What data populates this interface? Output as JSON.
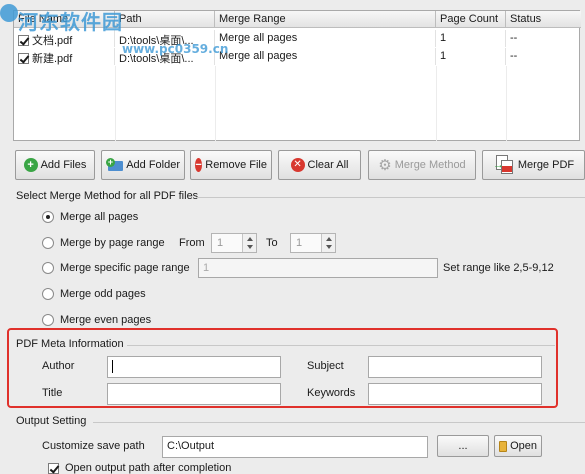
{
  "watermark": {
    "brand": "河东软件园",
    "url": "www.pc0359.cn"
  },
  "grid": {
    "columns": [
      "File Name",
      "Path",
      "Merge Range",
      "Page Count",
      "Status"
    ],
    "rows": [
      {
        "file": "文档.pdf",
        "path": "D:\\tools\\桌面\\...",
        "range": "Merge all pages",
        "count": "1",
        "status": "--"
      },
      {
        "file": "新建.pdf",
        "path": "D:\\tools\\桌面\\...",
        "range": "Merge all pages",
        "count": "1",
        "status": "--"
      }
    ]
  },
  "toolbar": {
    "add_files": "Add Files",
    "add_folder": "Add Folder",
    "remove_file": "Remove File",
    "clear_all": "Clear All",
    "merge_method": "Merge Method",
    "merge_pdf": "Merge PDF"
  },
  "method": {
    "title": "Select Merge Method for all PDF files",
    "all": "Merge all pages",
    "range": "Merge by page range",
    "from": "From",
    "to": "To",
    "from_value": "1",
    "to_value": "1",
    "specific": "Merge specific page range",
    "specific_value": "1",
    "specific_hint": "Set range like 2,5-9,12",
    "odd": "Merge odd pages",
    "even": "Merge even pages"
  },
  "meta": {
    "title": "PDF Meta Information",
    "author": "Author",
    "subject": "Subject",
    "title_label": "Title",
    "keywords": "Keywords"
  },
  "output": {
    "title": "Output Setting",
    "save_label": "Customize save path",
    "save_value": "C:\\Output",
    "browse": "...",
    "open": "Open",
    "open_after": "Open output path after completion"
  },
  "colors": {
    "highlight": "#e0312b",
    "watermark": "#3f9ad6"
  }
}
